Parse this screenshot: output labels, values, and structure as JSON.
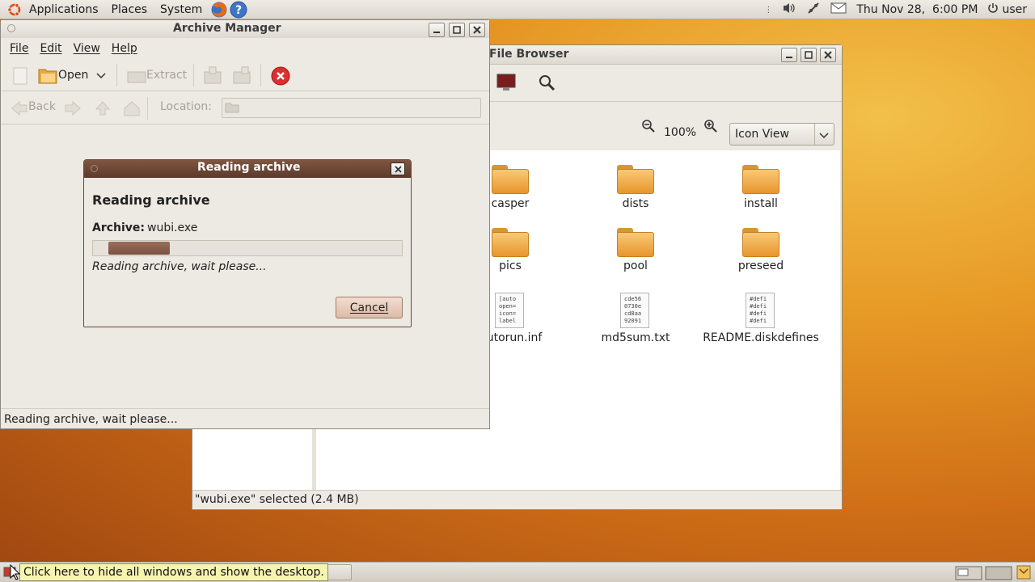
{
  "top_panel": {
    "menus": [
      "Applications",
      "Places",
      "System"
    ],
    "clock": "Thu Nov 28,  6:00 PM",
    "user": "user"
  },
  "file_browser": {
    "title": "File Browser",
    "zoom": "100%",
    "view_mode": "Icon View",
    "items": [
      {
        "name": "casper",
        "kind": "folder"
      },
      {
        "name": "dists",
        "kind": "folder"
      },
      {
        "name": "install",
        "kind": "folder"
      },
      {
        "name": "pics",
        "kind": "folder"
      },
      {
        "name": "pool",
        "kind": "folder"
      },
      {
        "name": "preseed",
        "kind": "folder"
      },
      {
        "name": "utorun.inf",
        "kind": "file",
        "preview": [
          "[auto",
          "open=",
          "icon=",
          "label"
        ]
      },
      {
        "name": "md5sum.txt",
        "kind": "file",
        "preview": [
          "cde56",
          "0730e",
          "cd8aa",
          "92091"
        ]
      },
      {
        "name": "README.diskdefines",
        "kind": "file",
        "preview": [
          "#defi",
          "#defi",
          "#defi",
          "#defi"
        ]
      }
    ],
    "status": "\"wubi.exe\" selected (2.4 MB)"
  },
  "archive_manager": {
    "title": "Archive Manager",
    "menus": [
      "File",
      "Edit",
      "View",
      "Help"
    ],
    "toolbar": {
      "open_label": "Open",
      "extract_label": "Extract"
    },
    "nav": {
      "back_label": "Back",
      "location_label": "Location:",
      "location_value": ""
    },
    "status": "Reading archive, wait please..."
  },
  "dialog": {
    "title": "Reading archive",
    "heading": "Reading archive",
    "archive_label": "Archive:",
    "archive_name": "wubi.exe",
    "progress_text": "Reading archive, wait please...",
    "cancel_label": "Cancel"
  },
  "bottom_panel": {
    "tooltip": "Click here to hide all windows and show the desktop."
  }
}
